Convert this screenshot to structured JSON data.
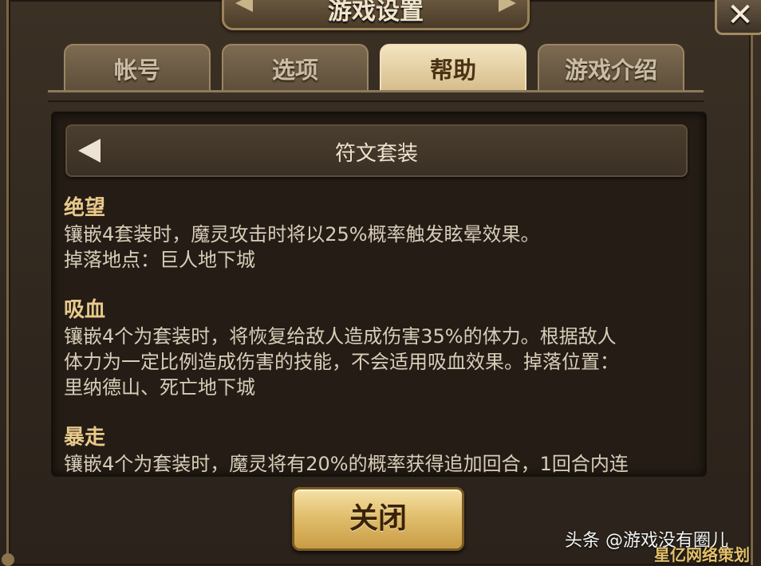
{
  "window": {
    "title": "游戏设置",
    "close_symbol": "✕"
  },
  "tabs": [
    {
      "label": "帐号",
      "active": false
    },
    {
      "label": "选项",
      "active": false
    },
    {
      "label": "帮助",
      "active": true
    },
    {
      "label": "游戏介绍",
      "active": false
    }
  ],
  "panel": {
    "header_title": "符文套装",
    "sections": [
      {
        "title": "绝望",
        "lines": [
          "镶嵌4套装时，魔灵攻击时将以25%概率触发眩晕效果。",
          "掉落地点：巨人地下城"
        ]
      },
      {
        "title": "吸血",
        "lines": [
          "镶嵌4个为套装时，将恢复给敌人造成伤害35%的体力。根据敌人",
          "体力为一定比例造成伤害的技能，不会适用吸血效果。掉落位置：",
          "里纳德山、死亡地下城"
        ]
      },
      {
        "title": "暴走",
        "lines": [
          "镶嵌4个为套装时，魔灵将有20%的概率获得追加回合，1回合内连"
        ]
      }
    ]
  },
  "close_button": {
    "label": "关闭"
  },
  "watermark": {
    "text": "头条 @游戏没有圈儿",
    "corner_text": "星亿网络策划"
  },
  "colors": {
    "accent_gold": "#e1bf6e",
    "section_title": "#e8c98a",
    "body_text": "#d8cdb8"
  },
  "icons": {
    "back": "back-arrow-icon",
    "close": "close-icon"
  }
}
